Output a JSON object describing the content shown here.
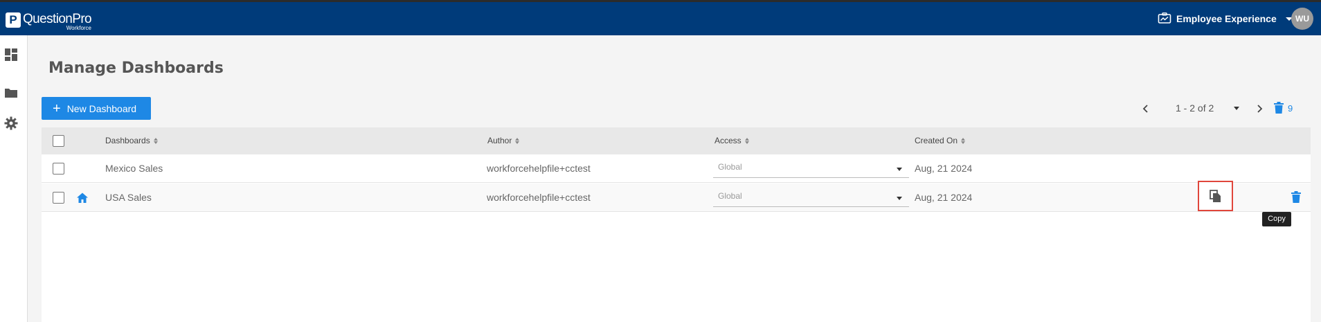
{
  "header": {
    "logo_name": "QuestionPro",
    "logo_sub": "Workforce",
    "logo_mark": "P",
    "product_label": "Employee Experience",
    "avatar_initials": "WU"
  },
  "sidebar": {
    "items": [
      {
        "icon": "dashboard-icon"
      },
      {
        "icon": "folder-icon"
      },
      {
        "icon": "gear-icon"
      }
    ]
  },
  "page": {
    "title": "Manage Dashboards",
    "new_button_label": "New Dashboard",
    "new_button_icon": "+"
  },
  "pagination": {
    "range_text": "1 - 2 of 2",
    "trash_count": "9"
  },
  "table": {
    "columns": [
      "Dashboards",
      "Author",
      "Access",
      "Created On"
    ],
    "rows": [
      {
        "name": "Mexico Sales",
        "author": "workforcehelpfile+cctest",
        "access": "Global",
        "created": "Aug, 21 2024",
        "home": false
      },
      {
        "name": "USA Sales",
        "author": "workforcehelpfile+cctest",
        "access": "Global",
        "created": "Aug, 21 2024",
        "home": true
      }
    ]
  },
  "tooltip": {
    "text": "Copy"
  },
  "colors": {
    "topbar": "#003b7a",
    "accent": "#1e88e5",
    "highlight": "#e0463b"
  }
}
